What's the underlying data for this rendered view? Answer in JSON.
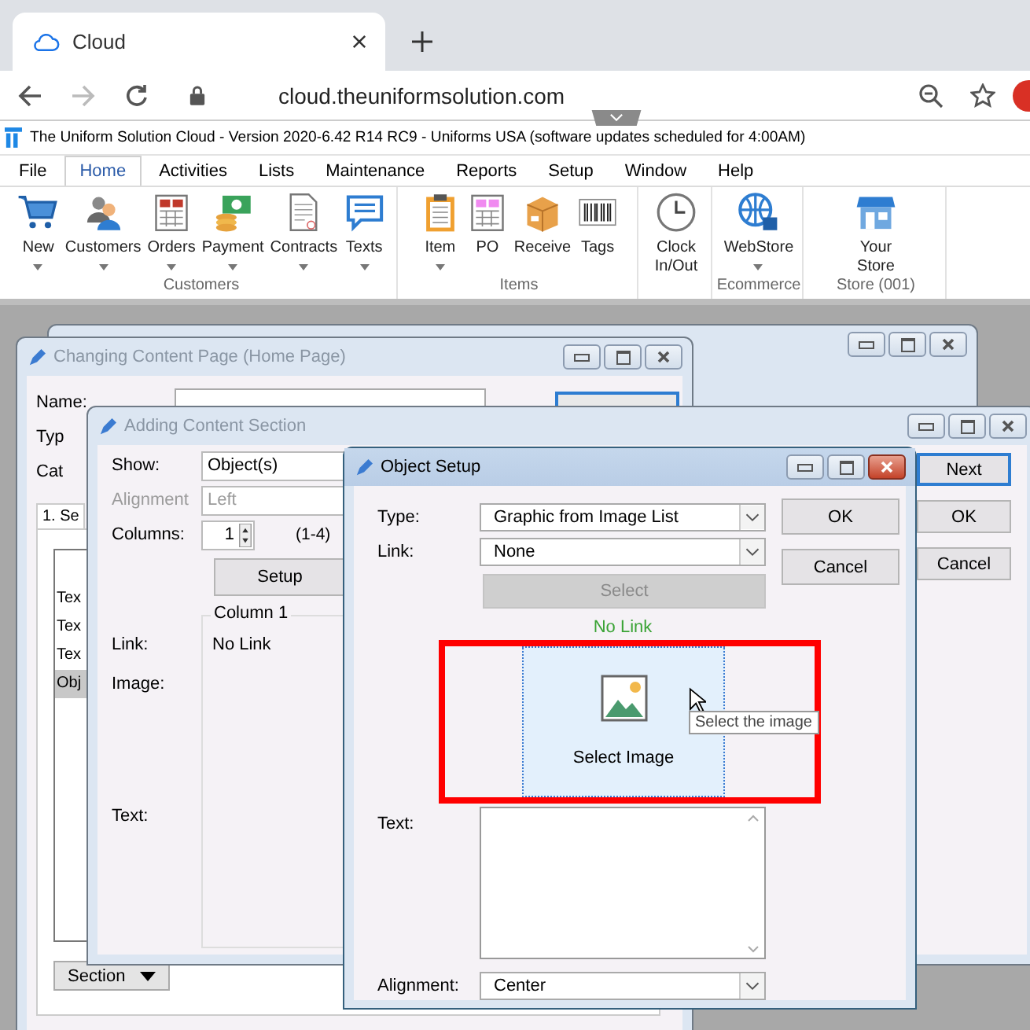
{
  "browser": {
    "tab": {
      "title": "Cloud",
      "selected": true
    },
    "url": "cloud.theuniformsolution.com"
  },
  "app": {
    "title": "The Uniform Solution Cloud - Version 2020-6.42 R14 RC9 - Uniforms USA (software updates scheduled for  4:00AM)",
    "menu": [
      {
        "label": "File",
        "selected": false
      },
      {
        "label": "Home",
        "selected": true
      },
      {
        "label": "Activities",
        "selected": false
      },
      {
        "label": "Lists",
        "selected": false
      },
      {
        "label": "Maintenance",
        "selected": false
      },
      {
        "label": "Reports",
        "selected": false
      },
      {
        "label": "Setup",
        "selected": false
      },
      {
        "label": "Window",
        "selected": false
      },
      {
        "label": "Help",
        "selected": false
      }
    ],
    "ribbon": [
      {
        "group": "Customers",
        "items": [
          {
            "label": "New",
            "dropdown": true
          },
          {
            "label": "Customers",
            "dropdown": true
          },
          {
            "label": "Orders",
            "dropdown": true
          },
          {
            "label": "Payment",
            "dropdown": true
          },
          {
            "label": "Contracts",
            "dropdown": true
          },
          {
            "label": "Texts",
            "dropdown": true
          }
        ]
      },
      {
        "group": "Items",
        "items": [
          {
            "label": "Item",
            "dropdown": true
          },
          {
            "label": "PO",
            "dropdown": false
          },
          {
            "label": "Receive",
            "dropdown": false
          },
          {
            "label": "Tags",
            "dropdown": false
          }
        ]
      },
      {
        "items": [
          {
            "label": "Clock In/Out",
            "dropdown": false
          }
        ]
      },
      {
        "group": "Ecommerce",
        "items": [
          {
            "label": "WebStore",
            "dropdown": true
          }
        ]
      },
      {
        "group": "Store (001)",
        "items": [
          {
            "label": "Your Store",
            "dropdown": false
          }
        ]
      }
    ]
  },
  "changing_content_page": {
    "title": "Changing Content Page  (Home Page)",
    "active": false,
    "fields": [
      {
        "label": "Name:"
      },
      {
        "label": "Typ"
      },
      {
        "label": "Cat"
      }
    ],
    "tab": "1. Se",
    "list": [
      {
        "label": "Tex",
        "selected": false
      },
      {
        "label": "Tex",
        "selected": false
      },
      {
        "label": "Tex",
        "selected": false
      },
      {
        "label": "Obj",
        "selected": true
      }
    ],
    "section_button": "Section"
  },
  "adding_content_section": {
    "title": "Adding Content Section",
    "active": false,
    "show": {
      "label": "Show:",
      "value": "Object(s)"
    },
    "alignment": {
      "label": "Alignment",
      "value": "Left",
      "disabled": true
    },
    "columns": {
      "label": "Columns:",
      "value": "1",
      "range": "(1-4)"
    },
    "setup_button": "Setup",
    "column_group": {
      "title": "Column 1",
      "link_label": "Link:",
      "link_value": "No Link",
      "image_label": "Image:",
      "text_label": "Text:"
    },
    "buttons": [
      {
        "label": "Next",
        "default": true
      },
      {
        "label": "OK",
        "default": false
      },
      {
        "label": "Cancel",
        "default": false
      }
    ]
  },
  "object_setup": {
    "title": "Object Setup",
    "active": true,
    "type": {
      "label": "Type:",
      "value": "Graphic from Image List"
    },
    "link": {
      "label": "Link:",
      "value": "None"
    },
    "select_button": {
      "label": "Select",
      "disabled": true
    },
    "link_status": "No Link",
    "select_image_button": "Select Image",
    "highlighted": true,
    "tooltip": "Select the image",
    "text_label": "Text:",
    "alignment": {
      "label": "Alignment:",
      "value": "Center"
    },
    "buttons": [
      {
        "label": "OK"
      },
      {
        "label": "Cancel"
      }
    ]
  }
}
